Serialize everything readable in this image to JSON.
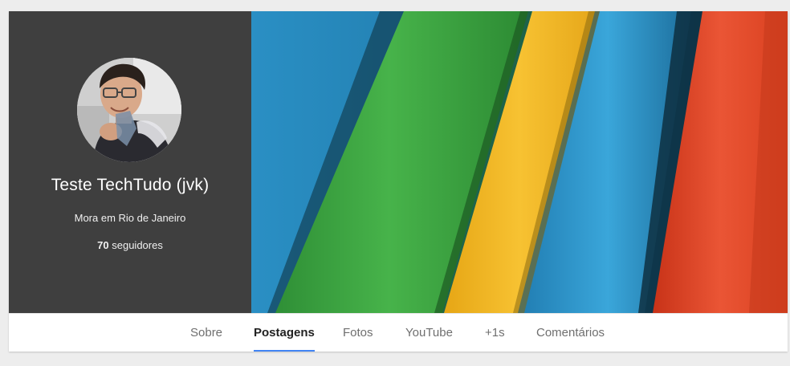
{
  "profile": {
    "name": "Teste TechTudo (jvk)",
    "location": "Mora em Rio de Janeiro",
    "followers_count": "70",
    "followers_label": "seguidores"
  },
  "tabs": [
    {
      "label": "Sobre",
      "active": false
    },
    {
      "label": "Postagens",
      "active": true
    },
    {
      "label": "Fotos",
      "active": false
    },
    {
      "label": "YouTube",
      "active": false
    },
    {
      "label": "+1s",
      "active": false
    },
    {
      "label": "Comentários",
      "active": false
    }
  ],
  "colors": {
    "profile_panel": "#3f3f3f",
    "active_tab_underline": "#4285f4",
    "cover_stripes": [
      "#1a82b8",
      "#33a23a",
      "#f2b51d",
      "#2f9bd0",
      "#e2452a"
    ]
  }
}
